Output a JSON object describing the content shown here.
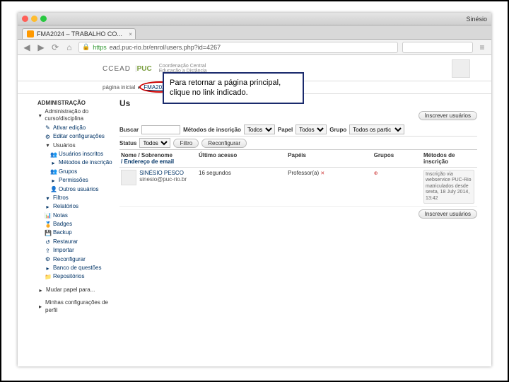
{
  "browser": {
    "tab_title": "FMA2024 – TRABALHO CO...",
    "user_chip": "Sinésio",
    "url_prefix": "https",
    "url": "ead.puc-rio.br/enrol/users.php?id=4267"
  },
  "header": {
    "logo1": "CCEAD",
    "logo2": "PUC",
    "subtitle1": "Coordenação Central",
    "subtitle2": "Educação a Distância",
    "user_name": "SINÉSIO PESCO"
  },
  "breadcrumb": {
    "home": "página inicial",
    "course": "FMA2024_2014.1",
    "section": "Us"
  },
  "sidebar": {
    "title": "ADMINISTRAÇÃO",
    "group1": "Administração do curso/disciplina",
    "items1": [
      {
        "icon": "✎",
        "label": "Ativar edição"
      },
      {
        "icon": "⚙",
        "label": "Editar configurações"
      }
    ],
    "subgroup": "Usuários",
    "items2": [
      {
        "icon": "👥",
        "label": "Usuários inscritos"
      },
      {
        "icon": "▸",
        "label": "Métodos de inscrição"
      },
      {
        "icon": "👥",
        "label": "Grupos"
      },
      {
        "icon": "▸",
        "label": "Permissões"
      },
      {
        "icon": "👤",
        "label": "Outros usuários"
      }
    ],
    "items3": [
      {
        "icon": "▾",
        "label": "Filtros"
      },
      {
        "icon": "▸",
        "label": "Relatórios"
      },
      {
        "icon": "📊",
        "label": "Notas"
      },
      {
        "icon": "🏅",
        "label": "Badges"
      },
      {
        "icon": "💾",
        "label": "Backup"
      },
      {
        "icon": "↺",
        "label": "Restaurar"
      },
      {
        "icon": "⇪",
        "label": "Importar"
      },
      {
        "icon": "⚙",
        "label": "Reconfigurar"
      },
      {
        "icon": "▸",
        "label": "Banco de questões"
      },
      {
        "icon": "📁",
        "label": "Repositórios"
      }
    ],
    "group2": "Mudar papel para...",
    "group3": "Minhas configurações de perfil"
  },
  "main": {
    "title": "Us",
    "enroll_btn": "Inscrever usuários",
    "filters": {
      "search_label": "Buscar",
      "methods_label": "Métodos de inscrição",
      "methods_value": "Todos",
      "role_label": "Papel",
      "role_value": "Todos",
      "group_label": "Grupo",
      "group_value": "Todos os partic",
      "status_label": "Status",
      "status_value": "Todos",
      "filter_btn": "Filtro",
      "reset_btn": "Reconfigurar"
    },
    "table": {
      "col1a": "Nome / Sobrenome",
      "col1b": "/ Endereço de email",
      "col2": "Último acesso",
      "col3": "Papéis",
      "col4": "Grupos",
      "col5": "Métodos de inscrição",
      "row": {
        "name": "SINÉSIO PESCO",
        "email": "sinesio@puc-rio.br",
        "last": "16 segundos",
        "role": "Professor(a)",
        "role_icon": "✕",
        "group_icon": "⊕",
        "method": "Inscrição via webservice PUC-Rio matriculados desde sexta, 18 July 2014, 13:42"
      }
    }
  },
  "callout": {
    "text": "Para retornar a página principal, clique no link indicado."
  }
}
